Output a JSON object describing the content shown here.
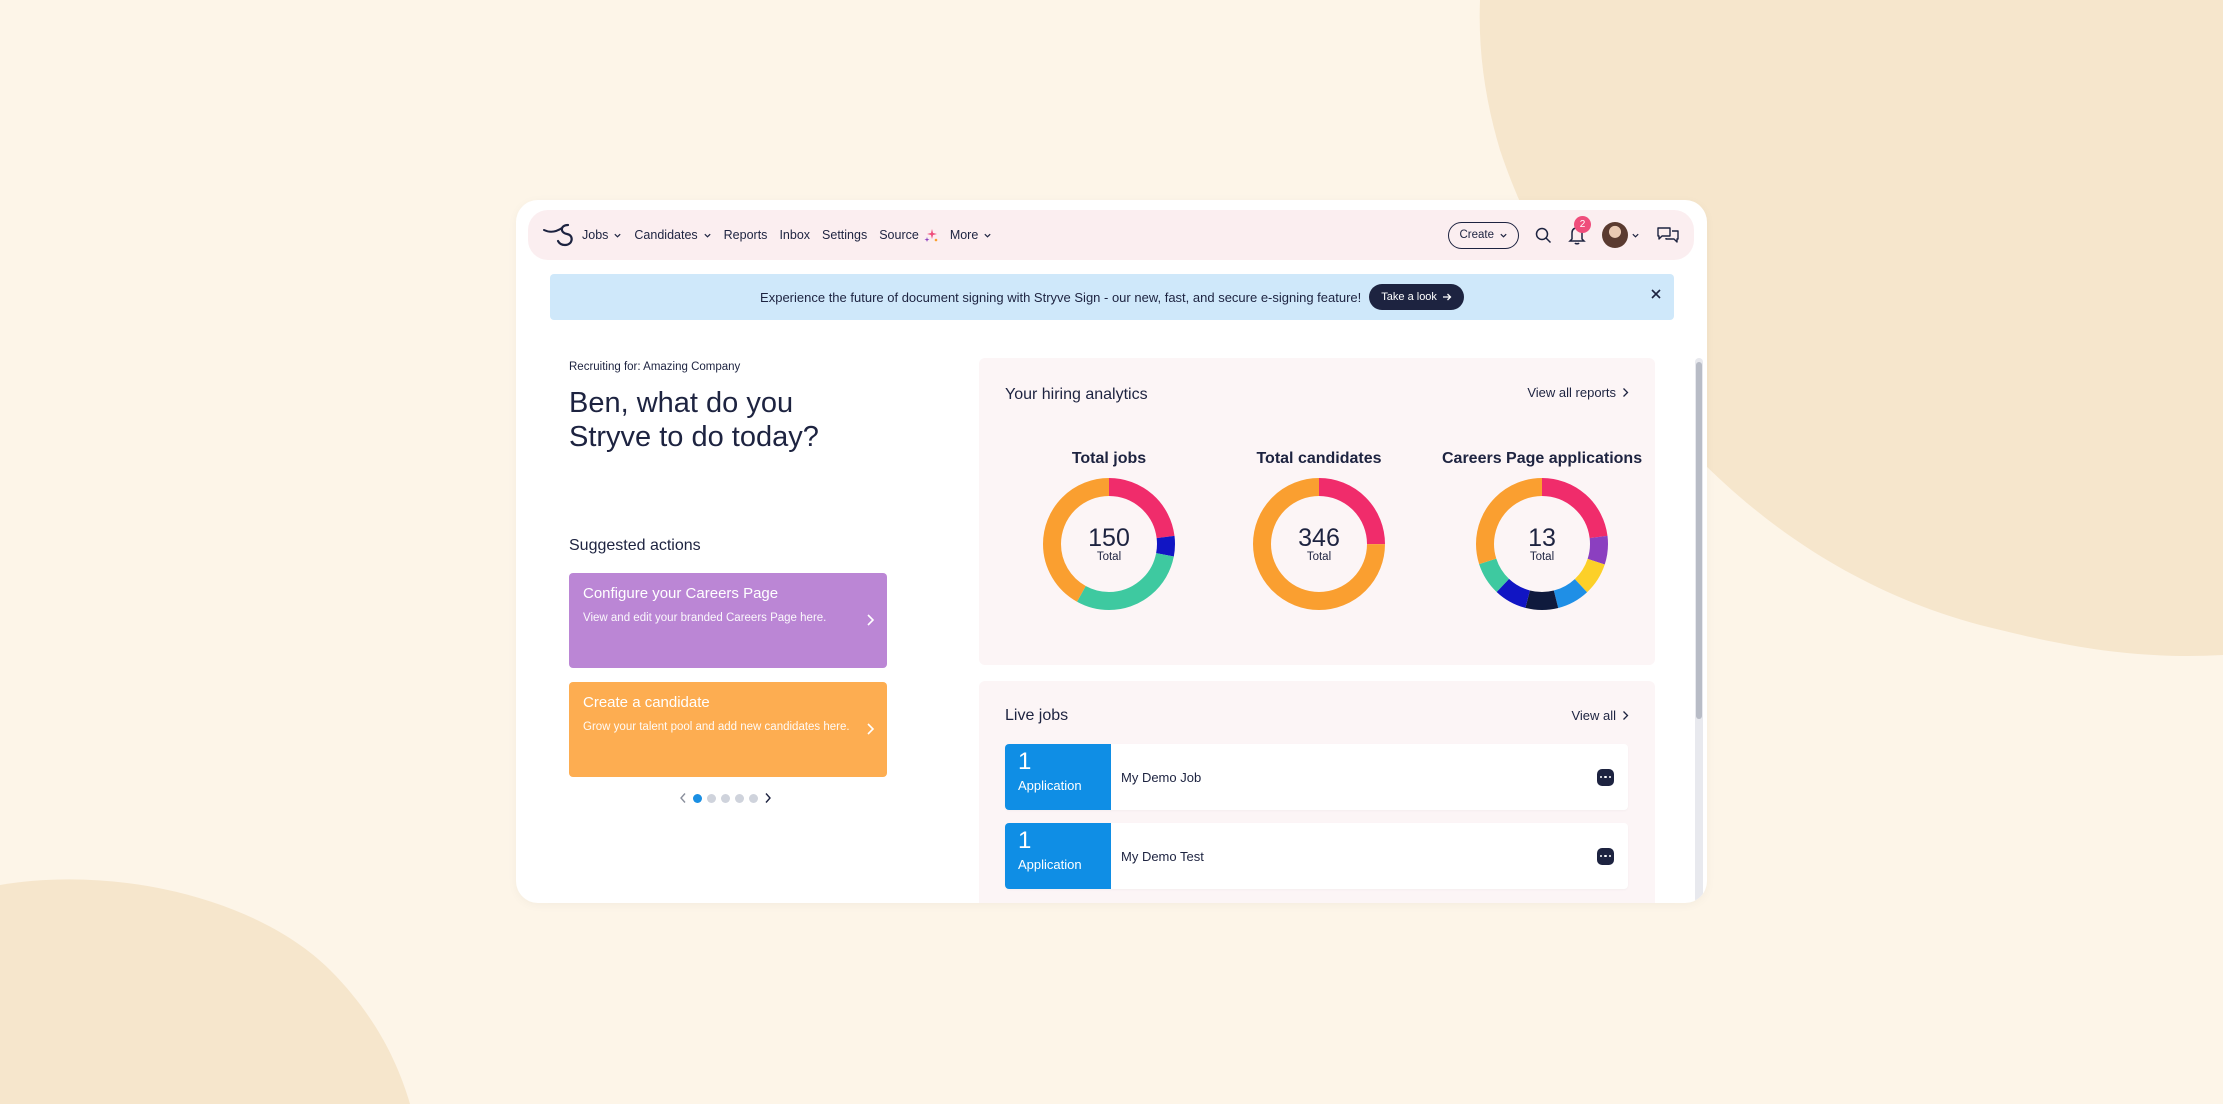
{
  "nav": {
    "items": [
      {
        "label": "Jobs",
        "has_dropdown": true
      },
      {
        "label": "Candidates",
        "has_dropdown": true
      },
      {
        "label": "Reports",
        "has_dropdown": false
      },
      {
        "label": "Inbox",
        "has_dropdown": false
      },
      {
        "label": "Settings",
        "has_dropdown": false
      },
      {
        "label": "Source",
        "has_dropdown": false
      },
      {
        "label": "More",
        "has_dropdown": true
      }
    ],
    "create_label": "Create",
    "notification_count": "2"
  },
  "banner": {
    "text": "Experience the future of document signing with Stryve Sign - our new, fast, and secure e-signing feature!",
    "button_label": "Take a look"
  },
  "left": {
    "recruiting_for": "Recruiting for: Amazing Company",
    "greeting": "Ben, what do you Stryve to do today?",
    "suggested_title": "Suggested actions",
    "actions": [
      {
        "title": "Configure your Careers Page",
        "desc": "View and edit your branded Careers Page here.",
        "color": "#bb86d5"
      },
      {
        "title": "Create a candidate",
        "desc": "Grow your talent pool and add new candidates here.",
        "color": "#fdad51"
      }
    ],
    "carousel": {
      "pages": 5,
      "active": 0
    }
  },
  "analytics": {
    "title": "Your hiring analytics",
    "link": "View all reports",
    "charts": [
      {
        "label": "Total jobs",
        "value": "150",
        "sub": "Total",
        "segments": [
          {
            "color": "#f02c6b",
            "value": 0.23
          },
          {
            "color": "#1115c4",
            "value": 0.05
          },
          {
            "color": "#3ec9a0",
            "value": 0.3
          },
          {
            "color": "#fa9f30",
            "value": 0.42
          }
        ]
      },
      {
        "label": "Total candidates",
        "value": "346",
        "sub": "Total",
        "segments": [
          {
            "color": "#f02c6b",
            "value": 0.25
          },
          {
            "color": "#fa9f30",
            "value": 0.75
          }
        ]
      },
      {
        "label": "Careers Page applications",
        "value": "13",
        "sub": "Total",
        "segments": [
          {
            "color": "#f02c6b",
            "value": 0.23
          },
          {
            "color": "#8b3fc0",
            "value": 0.07
          },
          {
            "color": "#fcd028",
            "value": 0.08
          },
          {
            "color": "#1f8fe6",
            "value": 0.08
          },
          {
            "color": "#0f1a3d",
            "value": 0.08
          },
          {
            "color": "#1115c4",
            "value": 0.08
          },
          {
            "color": "#3ec9a0",
            "value": 0.08
          },
          {
            "color": "#fa9f30",
            "value": 0.31
          }
        ]
      }
    ]
  },
  "live_jobs": {
    "title": "Live jobs",
    "link": "View all",
    "jobs": [
      {
        "count": "1",
        "count_label": "Application",
        "name": "My Demo Job"
      },
      {
        "count": "1",
        "count_label": "Application",
        "name": "My Demo Test"
      }
    ]
  }
}
